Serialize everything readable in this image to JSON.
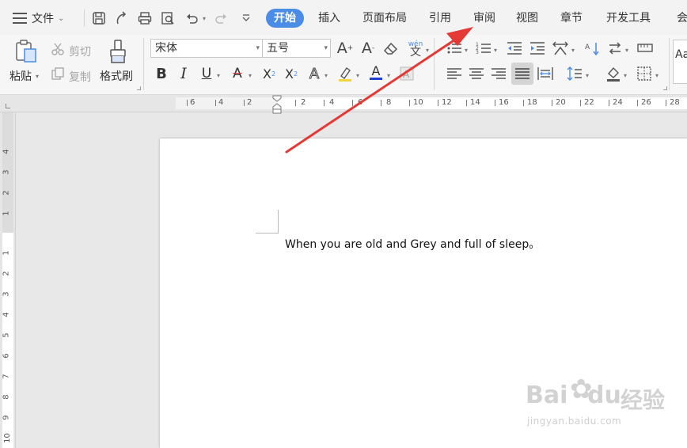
{
  "menu": {
    "file_label": "文件",
    "tabs": [
      "开始",
      "插入",
      "页面布局",
      "引用",
      "审阅",
      "视图",
      "章节",
      "开发工具",
      "会"
    ],
    "active_tab": "开始"
  },
  "ribbon": {
    "paste_label": "粘贴",
    "cut_label": "剪切",
    "copy_label": "复制",
    "format_painter_label": "格式刷",
    "font_name": "宋体",
    "font_size": "五号",
    "phonetic_label": "wén",
    "style_preview": "Aa"
  },
  "ruler": {
    "h_left": [
      "6",
      "4",
      "2"
    ],
    "h_right": [
      "2",
      "4",
      "6",
      "8",
      "10",
      "12",
      "14",
      "16",
      "18",
      "20",
      "22",
      "24",
      "26",
      "28"
    ],
    "v_top": [
      "4",
      "3",
      "2",
      "1"
    ],
    "v_body": [
      "1",
      "2",
      "3",
      "4",
      "5",
      "6",
      "7",
      "8",
      "9",
      "10"
    ]
  },
  "document": {
    "line1": "When you are old and Grey and full of sleep。"
  },
  "watermark": {
    "brand": "Bai",
    "brand2": "du",
    "cn": "经验",
    "url": "jingyan.baidu.com"
  },
  "colors": {
    "accent": "#4b8ce6",
    "arrow": "#e53935"
  }
}
